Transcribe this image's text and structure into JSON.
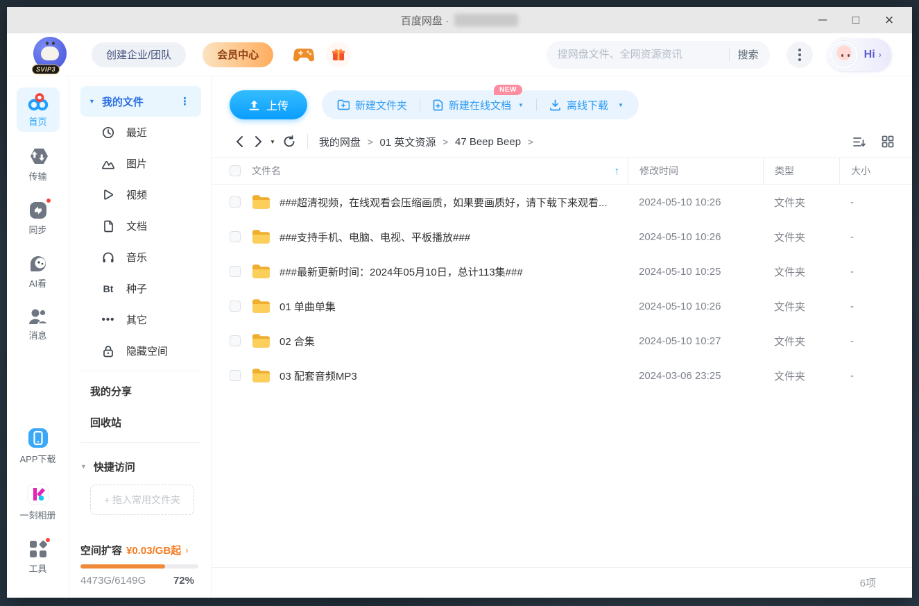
{
  "titlebar": {
    "title": "百度网盘 ·",
    "minimize": "─",
    "maximize": "□",
    "close": "×"
  },
  "header": {
    "svip_badge": "SVIP3",
    "create_team": "创建企业/团队",
    "vip_center": "会员中心",
    "search_placeholder": "搜网盘文件、全网资源资讯",
    "search_button": "搜索",
    "greeting": "Hi",
    "greeting_chevron": "›"
  },
  "rail": {
    "items": [
      {
        "label": "首页",
        "active": true
      },
      {
        "label": "传输"
      },
      {
        "label": "同步",
        "badge": true
      },
      {
        "label": "AI看"
      },
      {
        "label": "消息"
      }
    ],
    "bottom": [
      {
        "label": "APP下载"
      },
      {
        "label": "一刻相册"
      },
      {
        "label": "工具",
        "badge": true
      }
    ]
  },
  "sidenav": {
    "my_files": "我的文件",
    "categories": [
      {
        "label": "最近"
      },
      {
        "label": "图片"
      },
      {
        "label": "视频"
      },
      {
        "label": "文档"
      },
      {
        "label": "音乐"
      },
      {
        "label": "种子"
      },
      {
        "label": "其它"
      },
      {
        "label": "隐藏空间"
      }
    ],
    "links": [
      {
        "label": "我的分享"
      },
      {
        "label": "回收站"
      }
    ],
    "quick_access": "快捷访问",
    "drop_zone": "+ 拖入常用文件夹",
    "storage": {
      "expand_label": "空间扩容",
      "price": "¥0.03/GB起",
      "chevron": "›",
      "usage": "4473G/6149G",
      "percent": "72%",
      "percent_value": 72,
      "bar_color": "#f08a38"
    }
  },
  "toolbar": {
    "upload": "上传",
    "new_folder": "新建文件夹",
    "new_doc": "新建在线文档",
    "new_badge": "NEW",
    "offline_download": "离线下载"
  },
  "breadcrumb": {
    "items": [
      {
        "label": "我的网盘"
      },
      {
        "label": "01 英文资源"
      },
      {
        "label": "47 Beep Beep"
      }
    ]
  },
  "table": {
    "headers": {
      "name": "文件名",
      "modified": "修改时间",
      "type": "类型",
      "size": "大小"
    },
    "rows": [
      {
        "name": "###超清视频，在线观看会压缩画质，如果要画质好，请下载下来观看...",
        "modified": "2024-05-10 10:26",
        "type": "文件夹",
        "size": "-"
      },
      {
        "name": "###支持手机、电脑、电视、平板播放###",
        "modified": "2024-05-10 10:26",
        "type": "文件夹",
        "size": "-"
      },
      {
        "name": "###最新更新时间：2024年05月10日，总计113集###",
        "modified": "2024-05-10 10:25",
        "type": "文件夹",
        "size": "-"
      },
      {
        "name": "01 单曲单集",
        "modified": "2024-05-10 10:26",
        "type": "文件夹",
        "size": "-"
      },
      {
        "name": "02 合集",
        "modified": "2024-05-10 10:27",
        "type": "文件夹",
        "size": "-"
      },
      {
        "name": "03 配套音频MP3",
        "modified": "2024-03-06 23:25",
        "type": "文件夹",
        "size": "-"
      }
    ]
  },
  "statusbar": {
    "count": "6项"
  },
  "colors": {
    "accent_blue": "#0a9dfe",
    "accent_orange": "#f08a38",
    "vip_text": "#8d3c0e"
  }
}
